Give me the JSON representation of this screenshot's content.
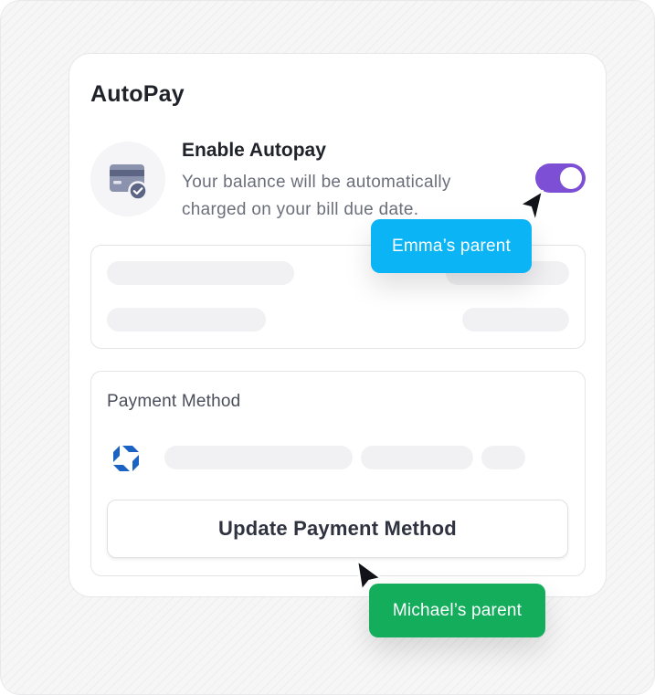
{
  "card": {
    "title": "AutoPay"
  },
  "autopay": {
    "heading": "Enable Autopay",
    "description": "Your balance will be automatically charged on your bill due date.",
    "enabled": true,
    "toggle_color": "#7d4fd4",
    "icon": "credit-card-check-icon"
  },
  "payment_method": {
    "label": "Payment Method",
    "bank_icon": "bank-logo-icon",
    "button_label": "Update Payment Method"
  },
  "cursors": [
    {
      "label": "Emma’s parent",
      "color": "#0ab4f5"
    },
    {
      "label": "Michael’s parent",
      "color": "#13ad5c"
    }
  ]
}
